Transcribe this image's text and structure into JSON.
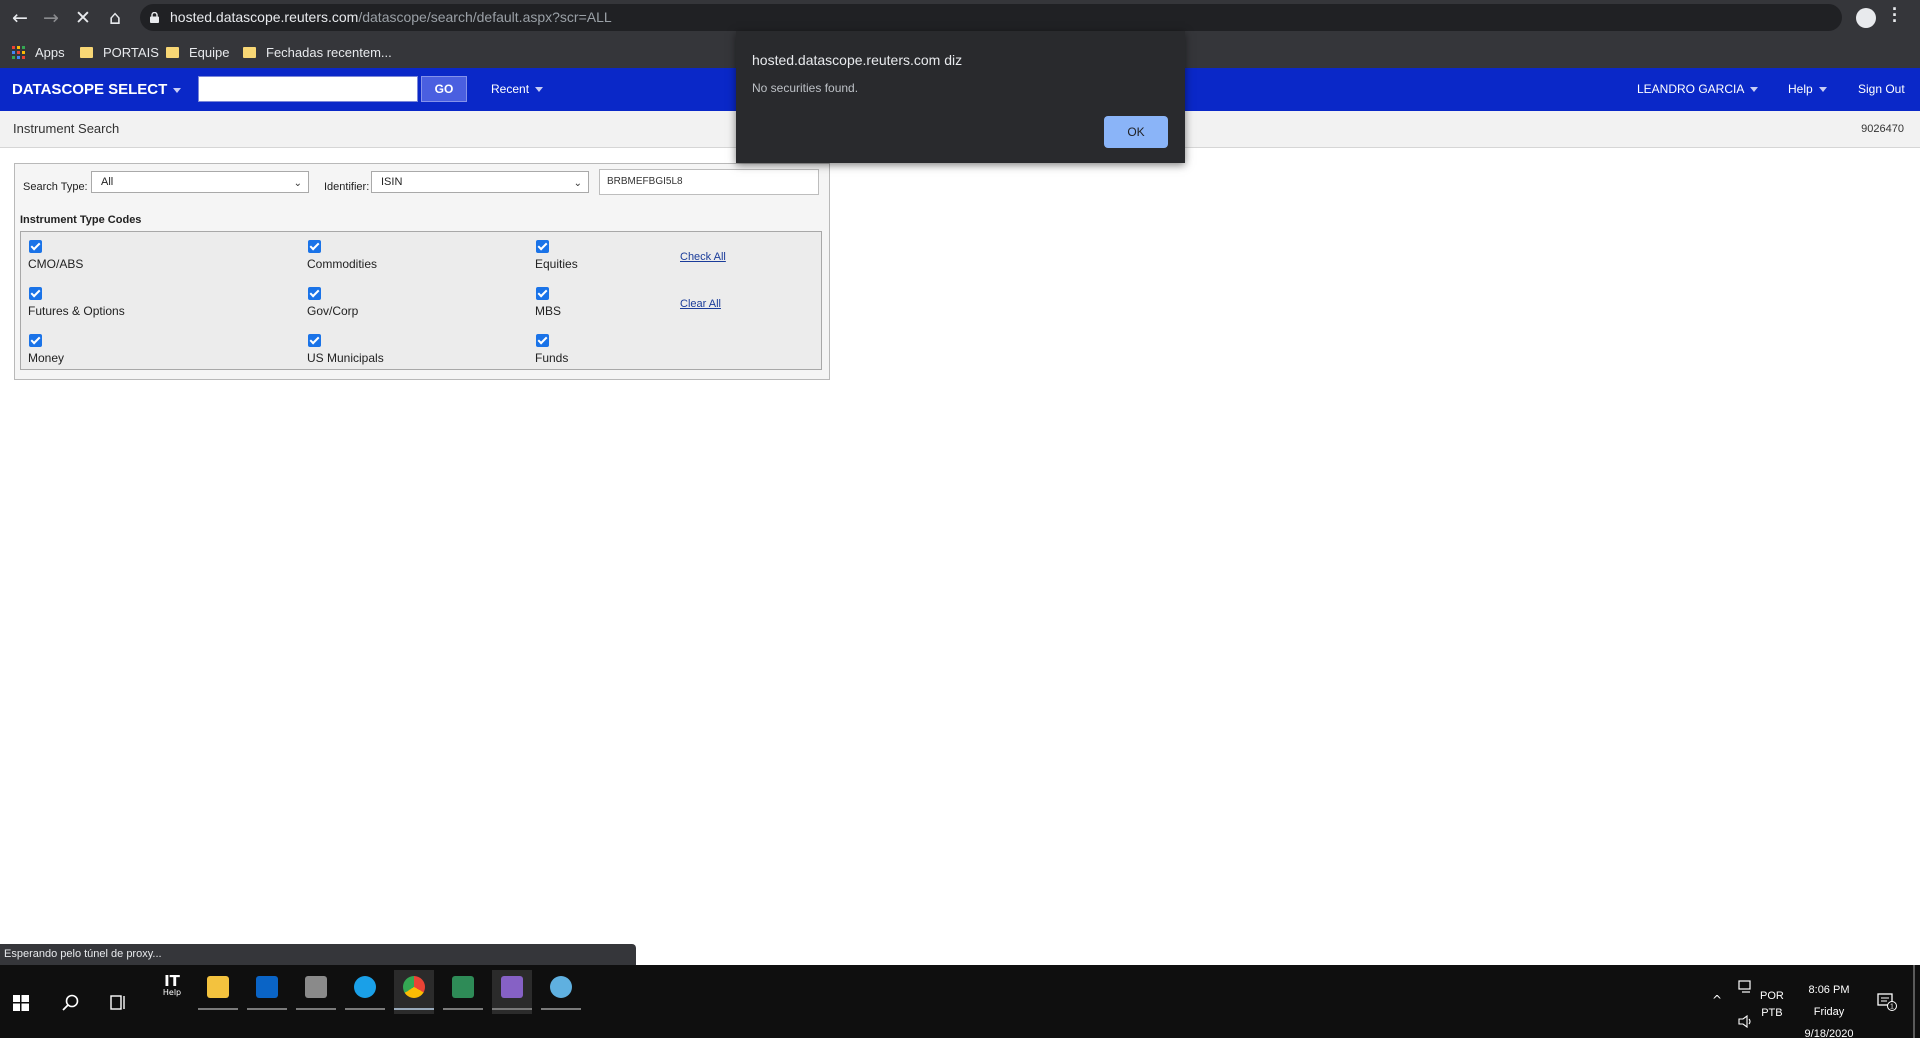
{
  "browser": {
    "url_host": "hosted.datascope.reuters.com",
    "url_path": "/datascope/search/default.aspx?scr=ALL",
    "bookmarks": [
      {
        "label": "Apps",
        "icon": "apps-grid-icon"
      },
      {
        "label": "PORTAIS",
        "icon": "folder-icon"
      },
      {
        "label": "Equipe",
        "icon": "folder-icon"
      },
      {
        "label": "Fechadas recentem...",
        "icon": "folder-icon"
      }
    ],
    "status_text": "Esperando pelo túnel de proxy..."
  },
  "header": {
    "brand": "DATASCOPE SELECT",
    "go_label": "GO",
    "recent_label": "Recent",
    "user_label": "LEANDRO GARCIA",
    "help_label": "Help",
    "signout_label": "Sign Out",
    "search_value": ""
  },
  "page": {
    "title": "Instrument Search",
    "id": "9026470"
  },
  "search": {
    "search_type_label": "Search Type:",
    "search_type_value": "All",
    "identifier_label": "Identifier:",
    "identifier_value": "ISIN",
    "identifier_input": "BRBMEFBGI5L8"
  },
  "codes": {
    "title": "Instrument Type Codes",
    "items": [
      {
        "label": "CMO/ABS",
        "checked": true
      },
      {
        "label": "Commodities",
        "checked": true
      },
      {
        "label": "Equities",
        "checked": true
      },
      {
        "label": "Futures & Options",
        "checked": true
      },
      {
        "label": "Gov/Corp",
        "checked": true
      },
      {
        "label": "MBS",
        "checked": true
      },
      {
        "label": "Money",
        "checked": true
      },
      {
        "label": "US Municipals",
        "checked": true
      },
      {
        "label": "Funds",
        "checked": true
      }
    ],
    "check_all": "Check All",
    "clear_all": "Clear All"
  },
  "dialog": {
    "title": "hosted.datascope.reuters.com diz",
    "message": "No securities found.",
    "ok_label": "OK"
  },
  "taskbar": {
    "it_help_top": "IT",
    "it_help_bottom": "Help",
    "lang_top": "POR",
    "lang_bottom": "PTB",
    "time": "8:06 PM",
    "day": "Friday",
    "date": "9/18/2020",
    "notification_count": "1"
  },
  "colors": {
    "brand_blue": "#0a28c8",
    "checkbox_blue": "#1a73e8",
    "dialog_button": "#8ab4f8"
  }
}
